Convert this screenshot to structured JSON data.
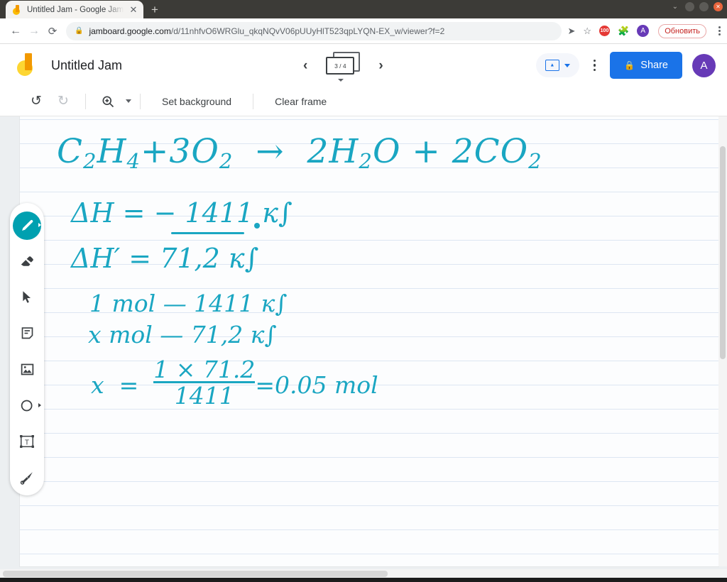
{
  "window": {
    "controls": [
      "chevron-down",
      "minimize",
      "maximize",
      "close"
    ],
    "minimize_glyph": "–",
    "maximize_glyph": "▢",
    "close_glyph": "✕",
    "chevron_glyph": "⌄"
  },
  "tabs": [
    {
      "title": "Untitled Jam - Google Jam",
      "favicon": "jamboard-icon",
      "close_glyph": "✕"
    }
  ],
  "new_tab": {
    "label": "+"
  },
  "omnibox": {
    "back_glyph": "←",
    "forward_glyph": "→",
    "reload_glyph": "⟳",
    "lock_glyph": "🔒",
    "url_domain": "jamboard.google.com",
    "url_path": "/d/11nhfvO6WRGlu_qkqNQvV06pUUyHlT523qpLYQN-EX_w/viewer?f=2",
    "share_glyph": "➤",
    "bookmark_glyph": "☆",
    "extension_badge": "100",
    "extensions_glyph": "🧩",
    "profile_initial": "A",
    "update_label": "Обновить"
  },
  "app": {
    "logo": "jamboard-logo",
    "title": "Untitled Jam",
    "prev_glyph": "‹",
    "next_glyph": "›",
    "frame_counter": "3 / 4",
    "present_label": "present-icon",
    "more_label": "more-options",
    "share_label": "Share",
    "share_lock_glyph": "🔒",
    "account_initial": "A"
  },
  "toolbar": {
    "undo_glyph": "↺",
    "redo_glyph": "↻",
    "zoom_glyph": "⊕",
    "set_background_label": "Set background",
    "clear_frame_label": "Clear frame"
  },
  "tool_palette": {
    "active": "pen",
    "items": [
      {
        "name": "pen-tool",
        "label": "Pen",
        "active": true
      },
      {
        "name": "eraser-tool",
        "label": "Eraser",
        "active": false
      },
      {
        "name": "select-tool",
        "label": "Select",
        "active": false
      },
      {
        "name": "sticky-note-tool",
        "label": "Sticky note",
        "active": false
      },
      {
        "name": "image-tool",
        "label": "Image",
        "active": false
      },
      {
        "name": "shape-tool",
        "label": "Shape",
        "active": false
      },
      {
        "name": "text-box-tool",
        "label": "Text box",
        "active": false
      },
      {
        "name": "laser-tool",
        "label": "Laser",
        "active": false
      }
    ]
  },
  "canvas": {
    "background": "lined-paper",
    "ink_color": "#1aa6c2",
    "line_color": "#dde6f2",
    "handwriting": [
      {
        "id": "equation",
        "text": "C2H4 + 3O2 → 2H2O + 2CO2"
      },
      {
        "id": "enthalpy",
        "text": "ΔH = − 1411 кJ"
      },
      {
        "id": "enthalpy-prime",
        "text": "ΔH' = 71,2 кJ"
      },
      {
        "id": "ratio-top",
        "text": "1 mol — 1411 кJ"
      },
      {
        "id": "ratio-bottom",
        "text": "x mol — 71,2 кJ"
      },
      {
        "id": "solution",
        "text": "x = (1 × 71,2) / 1411 = 0,05 mol"
      }
    ]
  },
  "scroll": {
    "vertical": "vertical-scrollbar",
    "horizontal": "horizontal-scrollbar"
  }
}
